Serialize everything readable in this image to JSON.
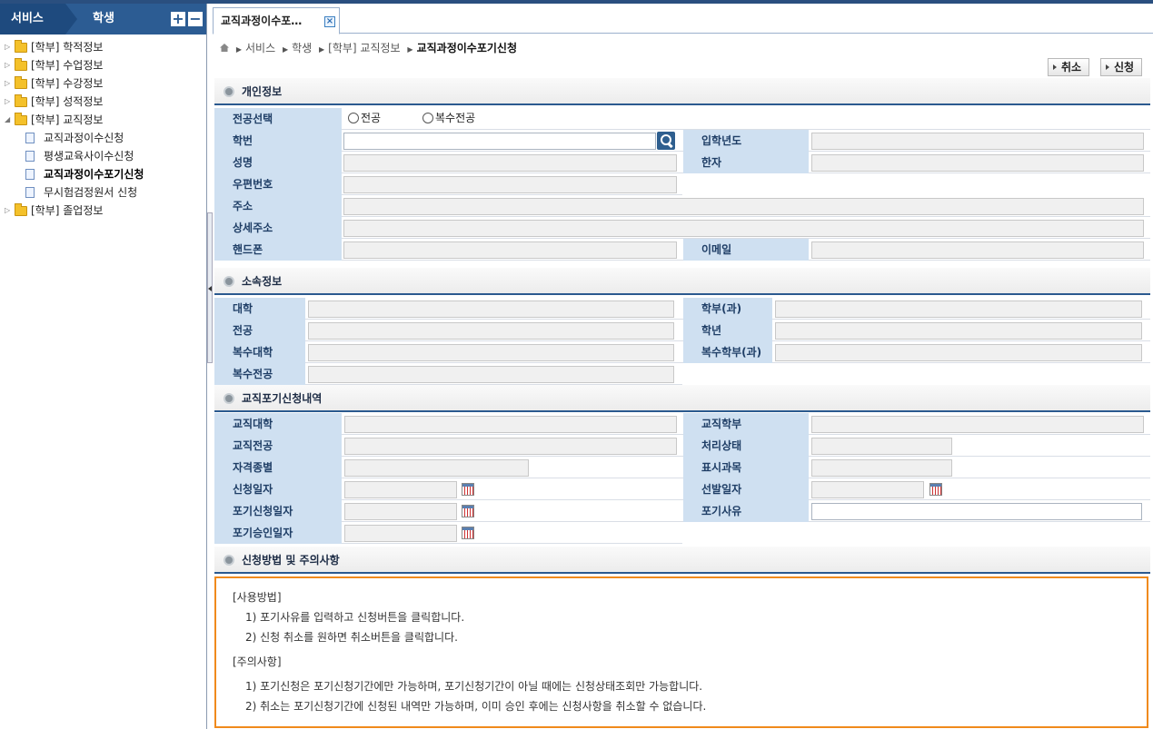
{
  "sidebar": {
    "service_label": "서비스",
    "student_label": "학생",
    "plus": "+",
    "minus": "−",
    "tree": [
      {
        "label": "[학부] 학적정보",
        "type": "folder",
        "arrow": "▷"
      },
      {
        "label": "[학부] 수업정보",
        "type": "folder",
        "arrow": "▷"
      },
      {
        "label": "[학부] 수강정보",
        "type": "folder",
        "arrow": "▷"
      },
      {
        "label": "[학부] 성적정보",
        "type": "folder",
        "arrow": "▷"
      },
      {
        "label": "[학부] 교직정보",
        "type": "folder",
        "arrow": "◢"
      },
      {
        "label": "교직과정이수신청",
        "type": "doc"
      },
      {
        "label": "평생교육사이수신청",
        "type": "doc"
      },
      {
        "label": "교직과정이수포기신청",
        "type": "doc",
        "selected": true
      },
      {
        "label": "무시험검정원서 신청",
        "type": "doc"
      },
      {
        "label": "[학부] 졸업정보",
        "type": "folder",
        "arrow": "▷"
      }
    ]
  },
  "tab": {
    "label": "교직과정이수포…",
    "close": "×"
  },
  "breadcrumb": {
    "items": [
      "서비스",
      "학생",
      "[학부] 교직정보"
    ],
    "current": "교직과정이수포기신청"
  },
  "toolbar": {
    "cancel": "취소",
    "apply": "신청"
  },
  "personal": {
    "title": "개인정보",
    "major_select": "전공선택",
    "radio1": "전공",
    "radio2": "복수전공",
    "student_no": "학번",
    "entry_year": "입학년도",
    "name": "성명",
    "hanja": "한자",
    "zip": "우편번호",
    "address": "주소",
    "address_detail": "상세주소",
    "phone": "핸드폰",
    "email": "이메일"
  },
  "affiliation": {
    "title": "소속정보",
    "college": "대학",
    "dept": "학부(과)",
    "major": "전공",
    "grade": "학년",
    "double_college": "복수대학",
    "double_dept": "복수학부(과)",
    "double_major": "복수전공"
  },
  "giveup": {
    "title": "교직포기신청내역",
    "t_college": "교직대학",
    "t_dept": "교직학부",
    "t_major": "교직전공",
    "status": "처리상태",
    "cert_type": "자격종별",
    "subject": "표시과목",
    "apply_date": "신청일자",
    "select_date": "선발일자",
    "giveup_date": "포기신청일자",
    "giveup_reason": "포기사유",
    "approve_date": "포기승인일자"
  },
  "notice": {
    "title": "신청방법 및 주의사항",
    "usage_head": "[사용방법]",
    "usage1": "1) 포기사유를 입력하고 신청버튼을 클릭합니다.",
    "usage2": "2) 신청 취소를 원하면 취소버튼을 클릭합니다.",
    "caution_head": "[주의사항]",
    "caution1": "1) 포기신청은 포기신청기간에만 가능하며, 포기신청기간이 아닐 때에는 신청상태조회만 가능합니다.",
    "caution2": "2) 취소는 포기신청기간에 신청된 내역만 가능하며, 이미 승인 후에는 신청사항을 취소할 수 없습니다."
  }
}
